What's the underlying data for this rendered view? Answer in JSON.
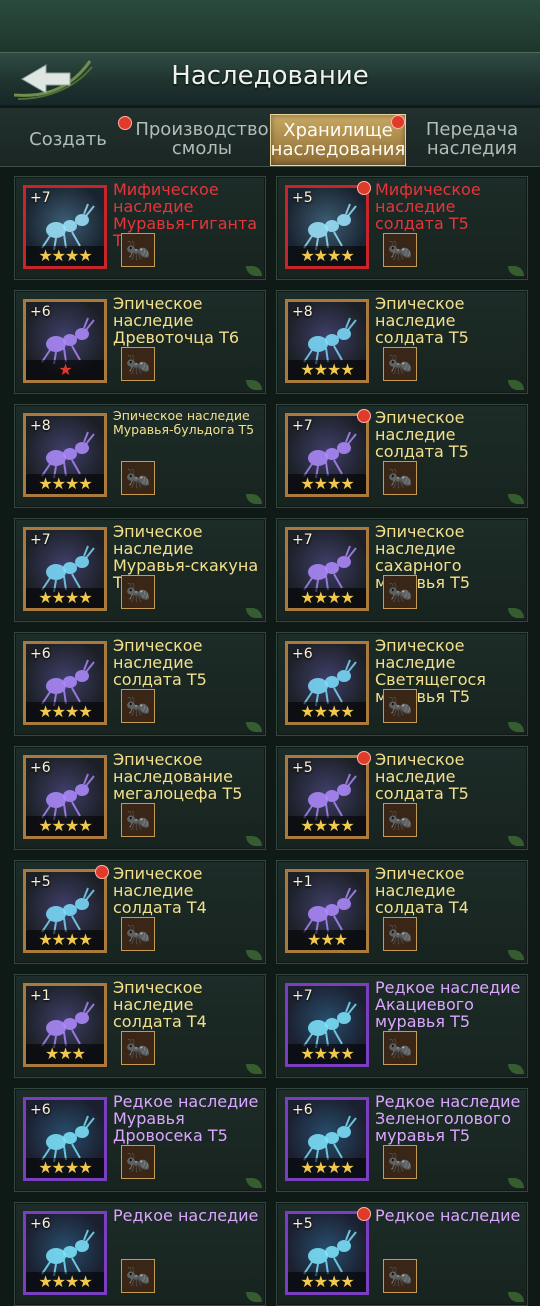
{
  "header": {
    "title": "Наследование"
  },
  "tabs": [
    {
      "label": "Создать",
      "dot": true
    },
    {
      "label": "Производство смолы",
      "dot": false
    },
    {
      "label": "Хранилище наследования",
      "dot": true,
      "active": true
    },
    {
      "label": "Передача наследия",
      "dot": false
    }
  ],
  "colors": {
    "mythic": "#e6353a",
    "epic": "#f3e08d",
    "rare": "#dba6ff",
    "star": "#f2c94c",
    "star_red": "#e0382d",
    "notification": "#e03a2a"
  },
  "cards": [
    {
      "level": "+7",
      "name": "Мифическое наследие Муравья-гиганта Т6",
      "rarity": "mythic",
      "stars": 4,
      "star_color": "gold",
      "dot": false
    },
    {
      "level": "+5",
      "name": "Мифическое наследие солдата Т5",
      "rarity": "mythic",
      "stars": 4,
      "star_color": "gold",
      "dot": true
    },
    {
      "level": "+6",
      "name": "Эпическое наследие Древоточца Т6",
      "rarity": "epic",
      "stars": 1,
      "star_color": "red",
      "dot": false
    },
    {
      "level": "+8",
      "name": "Эпическое наследие солдата Т5",
      "rarity": "epic",
      "stars": 4,
      "star_color": "gold",
      "dot": false
    },
    {
      "level": "+8",
      "name": "Эпическое наследие Муравья-бульдога Т5",
      "rarity": "epic",
      "stars": 4,
      "star_color": "gold",
      "dot": false,
      "small": true
    },
    {
      "level": "+7",
      "name": "Эпическое наследие солдата Т5",
      "rarity": "epic",
      "stars": 4,
      "star_color": "gold",
      "dot": true
    },
    {
      "level": "+7",
      "name": "Эпическое наследие Муравья-скакуна Т5",
      "rarity": "epic",
      "stars": 4,
      "star_color": "gold",
      "dot": false
    },
    {
      "level": "+7",
      "name": "Эпическое наследие сахарного муравья Т5",
      "rarity": "epic",
      "stars": 4,
      "star_color": "gold",
      "dot": false
    },
    {
      "level": "+6",
      "name": "Эпическое наследие солдата Т5",
      "rarity": "epic",
      "stars": 4,
      "star_color": "gold",
      "dot": false
    },
    {
      "level": "+6",
      "name": "Эпическое наследие Светящегося муравья Т5",
      "rarity": "epic",
      "stars": 4,
      "star_color": "gold",
      "dot": false
    },
    {
      "level": "+6",
      "name": "Эпическое наследование мегалоцефа Т5",
      "rarity": "epic",
      "stars": 4,
      "star_color": "gold",
      "dot": false
    },
    {
      "level": "+5",
      "name": "Эпическое наследие солдата Т5",
      "rarity": "epic",
      "stars": 4,
      "star_color": "gold",
      "dot": true
    },
    {
      "level": "+5",
      "name": "Эпическое наследие солдата Т4",
      "rarity": "epic",
      "stars": 4,
      "star_color": "gold",
      "dot": true
    },
    {
      "level": "+1",
      "name": "Эпическое наследие солдата Т4",
      "rarity": "epic",
      "stars": 3,
      "star_color": "gold",
      "dot": false
    },
    {
      "level": "+1",
      "name": "Эпическое наследие солдата Т4",
      "rarity": "epic",
      "stars": 3,
      "star_color": "gold",
      "dot": false
    },
    {
      "level": "+7",
      "name": "Редкое наследие Акациевого муравья Т5",
      "rarity": "rare",
      "stars": 4,
      "star_color": "gold",
      "dot": false
    },
    {
      "level": "+6",
      "name": "Редкое наследие Муравья Дровосека Т5",
      "rarity": "rare",
      "stars": 4,
      "star_color": "gold",
      "dot": false
    },
    {
      "level": "+6",
      "name": "Редкое наследие Зеленоголового муравья Т5",
      "rarity": "rare",
      "stars": 4,
      "star_color": "gold",
      "dot": false
    },
    {
      "level": "+6",
      "name": "Редкое наследие",
      "rarity": "rare",
      "stars": 4,
      "star_color": "gold",
      "dot": false
    },
    {
      "level": "+5",
      "name": "Редкое наследие",
      "rarity": "rare",
      "stars": 4,
      "star_color": "gold",
      "dot": true
    }
  ]
}
